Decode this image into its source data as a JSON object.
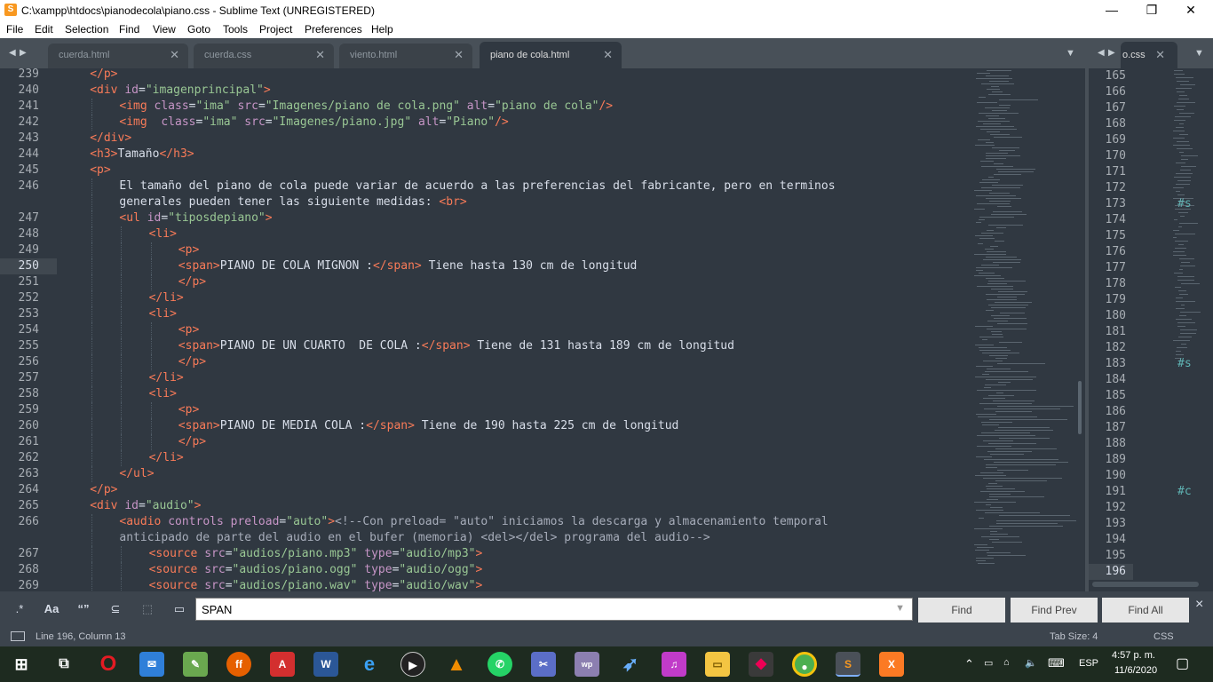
{
  "window": {
    "title": "C:\\xampp\\htdocs\\pianodecola\\piano.css - Sublime Text (UNREGISTERED)",
    "minimize": "—",
    "maximize": "❐",
    "close": "✕"
  },
  "menu": [
    "File",
    "Edit",
    "Selection",
    "Find",
    "View",
    "Goto",
    "Tools",
    "Project",
    "Preferences",
    "Help"
  ],
  "tabs": [
    {
      "label": "cuerda.html",
      "active": false
    },
    {
      "label": "cuerda.css",
      "active": false
    },
    {
      "label": "viento.html",
      "active": false
    },
    {
      "label": "piano de cola.html",
      "active": true
    }
  ],
  "right_tab": {
    "label": "o.css"
  },
  "editor": {
    "current_line": "250",
    "lines": [
      {
        "n": "239",
        "indent": 4,
        "tokens": [
          [
            "tg",
            "</p>"
          ]
        ]
      },
      {
        "n": "240",
        "indent": 4,
        "tokens": [
          [
            "tg",
            "<div "
          ],
          [
            "at",
            "id"
          ],
          [
            "pu",
            "="
          ],
          [
            "st",
            "\"imagenprincipal\""
          ],
          [
            "tg",
            ">"
          ]
        ]
      },
      {
        "n": "241",
        "indent": 8,
        "tokens": [
          [
            "tg",
            "<img "
          ],
          [
            "at",
            "class"
          ],
          [
            "pu",
            "="
          ],
          [
            "st",
            "\"ima\""
          ],
          [
            "pu",
            " "
          ],
          [
            "at",
            "src"
          ],
          [
            "pu",
            "="
          ],
          [
            "st",
            "\"Imagenes/piano de cola.png\""
          ],
          [
            "pu",
            " "
          ],
          [
            "at",
            "alt"
          ],
          [
            "pu",
            "="
          ],
          [
            "st",
            "\"piano de cola\""
          ],
          [
            "tg",
            "/>"
          ]
        ]
      },
      {
        "n": "242",
        "indent": 8,
        "tokens": [
          [
            "tg",
            "<img  "
          ],
          [
            "at",
            "class"
          ],
          [
            "pu",
            "="
          ],
          [
            "st",
            "\"ima\""
          ],
          [
            "pu",
            " "
          ],
          [
            "at",
            "src"
          ],
          [
            "pu",
            "="
          ],
          [
            "st",
            "\"Imagenes/piano.jpg\""
          ],
          [
            "pu",
            " "
          ],
          [
            "at",
            "alt"
          ],
          [
            "pu",
            "="
          ],
          [
            "st",
            "\"Piano\""
          ],
          [
            "tg",
            "/>"
          ]
        ]
      },
      {
        "n": "243",
        "indent": 4,
        "tokens": [
          [
            "tg",
            "</div>"
          ]
        ]
      },
      {
        "n": "244",
        "indent": 4,
        "tokens": [
          [
            "tg",
            "<h3>"
          ],
          [
            "pu",
            "Tamaño"
          ],
          [
            "tg",
            "</h3>"
          ]
        ]
      },
      {
        "n": "245",
        "indent": 4,
        "tokens": [
          [
            "tg",
            "<p>"
          ]
        ]
      },
      {
        "n": "246",
        "indent": 8,
        "tokens": [
          [
            "pu",
            "El tamaño del piano de cola puede variar de acuerdo a las preferencias del fabricante, pero en terminos"
          ]
        ]
      },
      {
        "n": "",
        "indent": 8,
        "tokens": [
          [
            "pu",
            "generales pueden tener las siguiente medidas: "
          ],
          [
            "tg",
            "<br>"
          ]
        ]
      },
      {
        "n": "247",
        "indent": 8,
        "tokens": [
          [
            "tg",
            "<ul "
          ],
          [
            "at",
            "id"
          ],
          [
            "pu",
            "="
          ],
          [
            "st",
            "\"tiposdepiano\""
          ],
          [
            "tg",
            ">"
          ]
        ]
      },
      {
        "n": "248",
        "indent": 12,
        "tokens": [
          [
            "tg",
            "<li>"
          ]
        ]
      },
      {
        "n": "249",
        "indent": 16,
        "tokens": [
          [
            "tg",
            "<p>"
          ]
        ]
      },
      {
        "n": "250",
        "indent": 16,
        "tokens": [
          [
            "tg",
            "<span>"
          ],
          [
            "pu",
            "PIANO DE COLA MIGNON :"
          ],
          [
            "tg",
            "</span>"
          ],
          [
            "pu",
            " Tiene hasta 130 cm de longitud"
          ]
        ]
      },
      {
        "n": "251",
        "indent": 16,
        "tokens": [
          [
            "tg",
            "</p>"
          ]
        ]
      },
      {
        "n": "252",
        "indent": 12,
        "tokens": [
          [
            "tg",
            "</li>"
          ]
        ]
      },
      {
        "n": "253",
        "indent": 12,
        "tokens": [
          [
            "tg",
            "<li>"
          ]
        ]
      },
      {
        "n": "254",
        "indent": 16,
        "tokens": [
          [
            "tg",
            "<p>"
          ]
        ]
      },
      {
        "n": "255",
        "indent": 16,
        "tokens": [
          [
            "tg",
            "<span>"
          ],
          [
            "pu",
            "PIANO DE UN CUARTO  DE COLA :"
          ],
          [
            "tg",
            "</span>"
          ],
          [
            "pu",
            " Tiene de 131 hasta 189 cm de longitud"
          ]
        ]
      },
      {
        "n": "256",
        "indent": 16,
        "tokens": [
          [
            "tg",
            "</p>"
          ]
        ]
      },
      {
        "n": "257",
        "indent": 12,
        "tokens": [
          [
            "tg",
            "</li>"
          ]
        ]
      },
      {
        "n": "258",
        "indent": 12,
        "tokens": [
          [
            "tg",
            "<li>"
          ]
        ]
      },
      {
        "n": "259",
        "indent": 16,
        "tokens": [
          [
            "tg",
            "<p>"
          ]
        ]
      },
      {
        "n": "260",
        "indent": 16,
        "tokens": [
          [
            "tg",
            "<span>"
          ],
          [
            "pu",
            "PIANO DE MEDIA COLA :"
          ],
          [
            "tg",
            "</span>"
          ],
          [
            "pu",
            " Tiene de 190 hasta 225 cm de longitud"
          ]
        ]
      },
      {
        "n": "261",
        "indent": 16,
        "tokens": [
          [
            "tg",
            "</p>"
          ]
        ]
      },
      {
        "n": "262",
        "indent": 12,
        "tokens": [
          [
            "tg",
            "</li>"
          ]
        ]
      },
      {
        "n": "263",
        "indent": 8,
        "tokens": [
          [
            "tg",
            "</ul>"
          ]
        ]
      },
      {
        "n": "264",
        "indent": 4,
        "tokens": [
          [
            "tg",
            "</p>"
          ]
        ]
      },
      {
        "n": "265",
        "indent": 4,
        "tokens": [
          [
            "tg",
            "<div "
          ],
          [
            "at",
            "id"
          ],
          [
            "pu",
            "="
          ],
          [
            "st",
            "\"audio\""
          ],
          [
            "tg",
            ">"
          ]
        ]
      },
      {
        "n": "266",
        "indent": 8,
        "tokens": [
          [
            "tg",
            "<audio "
          ],
          [
            "at",
            "controls preload"
          ],
          [
            "pu",
            "="
          ],
          [
            "st",
            "\"auto\""
          ],
          [
            "tg",
            ">"
          ],
          [
            "cm",
            "<!--Con preload= \"auto\" iniciamos la descarga y almacenamiento temporal"
          ]
        ]
      },
      {
        "n": "",
        "indent": 8,
        "tokens": [
          [
            "cm",
            "anticipado de parte del audio en el bufer (memoria) <del></del> programa del audio-->"
          ]
        ]
      },
      {
        "n": "267",
        "indent": 12,
        "tokens": [
          [
            "tg",
            "<source "
          ],
          [
            "at",
            "src"
          ],
          [
            "pu",
            "="
          ],
          [
            "st",
            "\"audios/piano.mp3\""
          ],
          [
            "pu",
            " "
          ],
          [
            "at",
            "type"
          ],
          [
            "pu",
            "="
          ],
          [
            "st",
            "\"audio/mp3\""
          ],
          [
            "tg",
            ">"
          ]
        ]
      },
      {
        "n": "268",
        "indent": 12,
        "tokens": [
          [
            "tg",
            "<source "
          ],
          [
            "at",
            "src"
          ],
          [
            "pu",
            "="
          ],
          [
            "st",
            "\"audios/piano.ogg\""
          ],
          [
            "pu",
            " "
          ],
          [
            "at",
            "type"
          ],
          [
            "pu",
            "="
          ],
          [
            "st",
            "\"audio/ogg\""
          ],
          [
            "tg",
            ">"
          ]
        ]
      },
      {
        "n": "269",
        "indent": 12,
        "tokens": [
          [
            "tg",
            "<source "
          ],
          [
            "at",
            "src"
          ],
          [
            "pu",
            "="
          ],
          [
            "st",
            "\"audios/piano.wav\""
          ],
          [
            "pu",
            " "
          ],
          [
            "at",
            "type"
          ],
          [
            "pu",
            "="
          ],
          [
            "st",
            "\"audio/wav\""
          ],
          [
            "tg",
            ">"
          ]
        ]
      }
    ]
  },
  "right_pane": {
    "lines": [
      "165",
      "166",
      "167",
      "168",
      "169",
      "170",
      "171",
      "172",
      "173",
      "174",
      "175",
      "176",
      "177",
      "178",
      "179",
      "180",
      "181",
      "182",
      "183",
      "184",
      "185",
      "186",
      "187",
      "188",
      "189",
      "190",
      "191",
      "192",
      "193",
      "194",
      "195",
      "196"
    ],
    "current_line": "196",
    "snippets": [
      {
        "line": "173",
        "text": "#s"
      },
      {
        "line": "183",
        "text": "#s"
      },
      {
        "line": "191",
        "text": "#c"
      }
    ]
  },
  "find": {
    "regex_icon": ".*",
    "case_icon": "Aa",
    "word_icon": "“”",
    "wrap_icon": "⊆",
    "selection_icon": "⬚",
    "highlight_icon": "▭",
    "value": "SPAN",
    "find": "Find",
    "find_prev": "Find Prev",
    "find_all": "Find All",
    "close": "×"
  },
  "status": {
    "position": "Line 196, Column 13",
    "tab_size": "Tab Size: 4",
    "syntax": "CSS"
  },
  "taskbar": {
    "apps": [
      "windows-start",
      "task-view",
      "opera",
      "mail",
      "paint",
      "firefox",
      "acrobat",
      "word",
      "edge",
      "media-player",
      "vlc",
      "whatsapp",
      "snipping",
      "wp",
      "spark",
      "itunes",
      "file-explorer",
      "git",
      "chrome",
      "sublime-text",
      "xampp"
    ],
    "lang": "ESP",
    "time": "4:57 p. m.",
    "date": "11/6/2020"
  }
}
